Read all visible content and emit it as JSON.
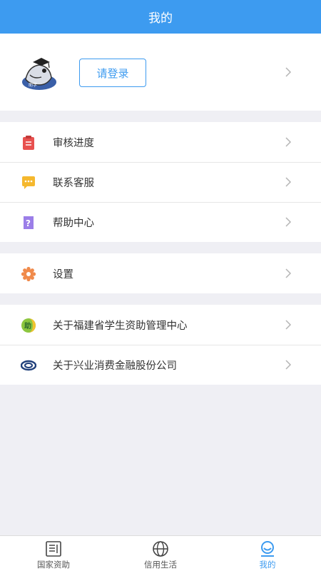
{
  "header": {
    "title": "我的"
  },
  "profile": {
    "login_label": "请登录"
  },
  "menu": {
    "group1": [
      {
        "label": "审核进度",
        "icon": "clipboard-icon"
      },
      {
        "label": "联系客服",
        "icon": "chat-bubble-icon"
      },
      {
        "label": "帮助中心",
        "icon": "help-icon"
      }
    ],
    "group2": [
      {
        "label": "设置",
        "icon": "gear-icon"
      }
    ],
    "group3": [
      {
        "label": "关于福建省学生资助管理中心",
        "icon": "fujian-aid-logo-icon"
      },
      {
        "label": "关于兴业消费金融股份公司",
        "icon": "cib-logo-icon"
      }
    ]
  },
  "tabbar": {
    "tabs": [
      {
        "label": "国家资助",
        "icon": "newspaper-icon",
        "active": false
      },
      {
        "label": "信用生活",
        "icon": "globe-icon",
        "active": false
      },
      {
        "label": "我的",
        "icon": "person-icon",
        "active": true
      }
    ]
  },
  "colors": {
    "accent": "#3d9bf0",
    "background": "#efeff4"
  }
}
